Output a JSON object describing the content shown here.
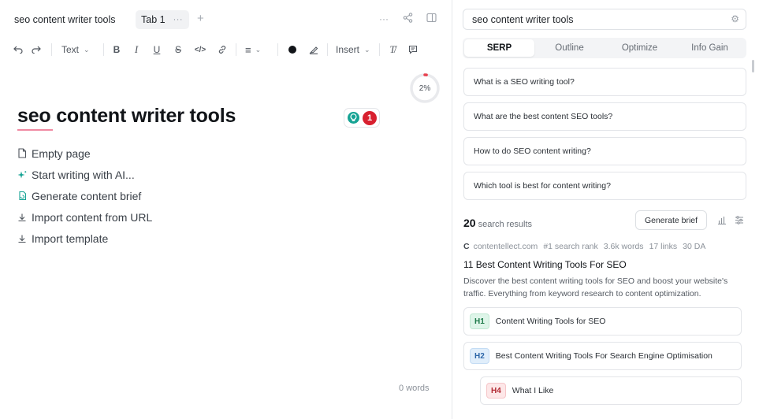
{
  "editor": {
    "doc_title": "seo content writer tools",
    "tab_label": "Tab 1",
    "tab_menu": "···",
    "tab_add": "+",
    "more": "···",
    "toolbar": {
      "text_style": "Text",
      "insert": "Insert"
    },
    "progress": "2%",
    "progress_fraction": 0.02,
    "heading": "seo content writer tools",
    "issue_count": "1",
    "actions": [
      {
        "label": "Empty page",
        "icon": "page-icon"
      },
      {
        "label": "Start writing with AI...",
        "icon": "sparkle-icon"
      },
      {
        "label": "Generate content brief",
        "icon": "brief-icon"
      },
      {
        "label": "Import content from URL",
        "icon": "download-icon"
      },
      {
        "label": "Import template",
        "icon": "download-icon"
      }
    ],
    "word_count": "0 words"
  },
  "panel": {
    "search_value": "seo content writer tools",
    "tabs": [
      "SERP",
      "Outline",
      "Optimize",
      "Info Gain"
    ],
    "active_tab": "SERP",
    "questions": [
      "What is a SEO writing tool?",
      "What are the best content SEO tools?",
      "How to do SEO content writing?",
      "Which tool is best for content writing?"
    ],
    "results_count": "20",
    "results_label": "search results",
    "generate_brief": "Generate brief",
    "result": {
      "favicon": "C",
      "domain": "contentellect.com",
      "rank": "#1 search rank",
      "words": "3.6k words",
      "links": "17 links",
      "da": "30 DA",
      "title": "11 Best Content Writing Tools For SEO",
      "description": "Discover the best content writing tools for SEO and boost your website's traffic. Everything from keyword research to content optimization.",
      "headings": [
        {
          "tag": "H1",
          "text": "Content Writing Tools for SEO"
        },
        {
          "tag": "H2",
          "text": "Best Content Writing Tools For Search Engine Optimisation"
        },
        {
          "tag": "H4",
          "text": "What I Like"
        }
      ]
    }
  },
  "colors": {
    "accent_green": "#16a394",
    "alert_red": "#d8202f",
    "progress_red": "#e8424f"
  }
}
